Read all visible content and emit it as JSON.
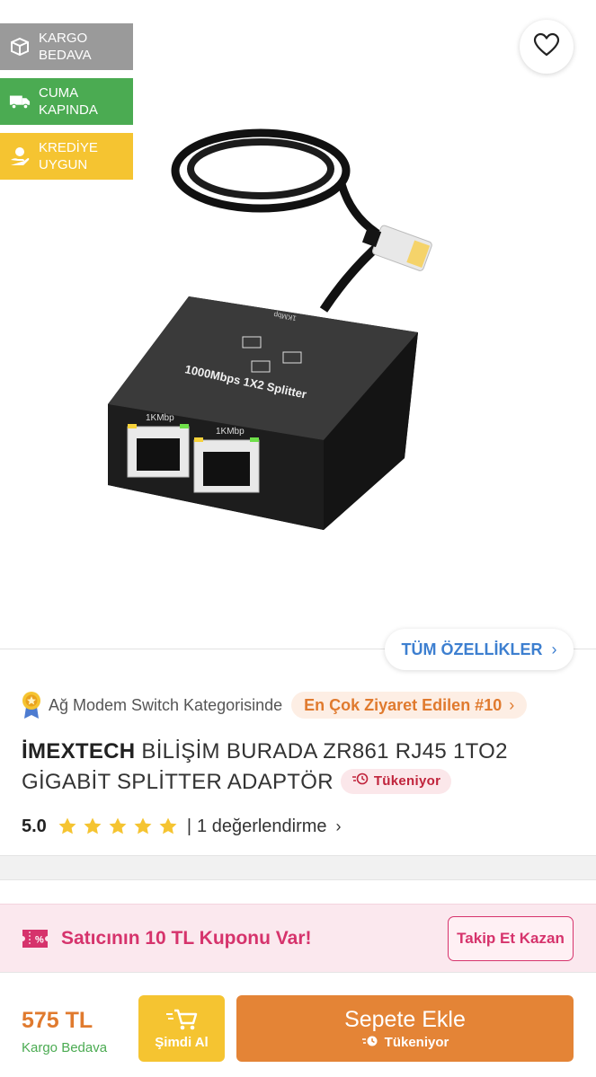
{
  "badges": [
    {
      "label": "KARGO\nBEDAVA",
      "icon": "box-icon",
      "color": "#9a9a9a"
    },
    {
      "label": "CUMA\nKAPINDA",
      "icon": "truck-icon",
      "color": "#4bab52"
    },
    {
      "label": "KREDİYE\nUYGUN",
      "icon": "credit-hand-icon",
      "color": "#f5c431"
    }
  ],
  "gallery": {
    "product_image_labels": {
      "splitter_text": "1000Mbps 1X2 Splitter",
      "port_label_1": "1KMbp",
      "port_label_2": "1KMbp",
      "cable_label": "1KMbp"
    },
    "all_specs_label": "TÜM ÖZELLİKLER"
  },
  "rank": {
    "category_text": "Ağ Modem Switch Kategorisinde",
    "pill_text": "En Çok Ziyaret Edilen #10"
  },
  "product": {
    "brand": "İMEXTECH",
    "title": " BİLİŞİM BURADA ZR861 RJ45 1TO2 GİGABİT SPLİTTER ADAPTÖR",
    "stock_badge": "Tükeniyor"
  },
  "rating": {
    "score": "5.0",
    "stars": 5,
    "separator": "|",
    "count_text": "1 değerlendirme"
  },
  "coupon": {
    "text": "Satıcının 10 TL Kuponu Var!",
    "follow_label": "Takip Et Kazan"
  },
  "bottom_bar": {
    "price": "575 TL",
    "shipping": "Kargo Bedava",
    "buy_now_label": "Şimdi Al",
    "add_to_cart_label": "Sepete Ekle",
    "add_to_cart_sub": "Tükeniyor"
  },
  "colors": {
    "accent_orange": "#e48436",
    "yellow": "#f5c431",
    "green": "#4bab52",
    "pink": "#d6336c",
    "blue_link": "#3d7fd0"
  }
}
